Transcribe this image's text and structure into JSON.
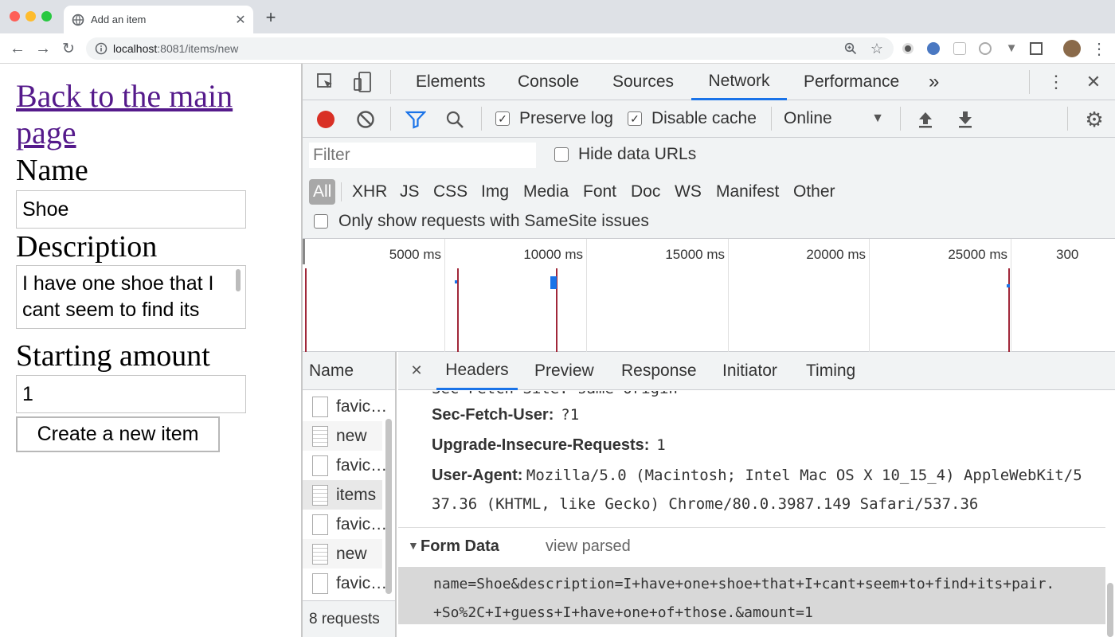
{
  "browser": {
    "tab_title": "Add an item",
    "url_host": "localhost",
    "url_rest": ":8081/items/new",
    "new_tab_symbol": "+"
  },
  "page": {
    "back_link": "Back to the main page",
    "name_label": "Name",
    "name_value": "Shoe",
    "description_label": "Description",
    "description_value": "I have one shoe that I cant seem to find its",
    "amount_label": "Starting amount",
    "amount_value": "1",
    "submit_label": "Create a new item"
  },
  "devtools": {
    "tabs": [
      "Elements",
      "Console",
      "Sources",
      "Network",
      "Performance"
    ],
    "active_tab": "Network",
    "more": "»",
    "preserve_log": "Preserve log",
    "disable_cache": "Disable cache",
    "throttle": "Online",
    "filter_placeholder": "Filter",
    "hide_data_urls": "Hide data URLs",
    "types": [
      "All",
      "XHR",
      "JS",
      "CSS",
      "Img",
      "Media",
      "Font",
      "Doc",
      "WS",
      "Manifest",
      "Other"
    ],
    "samesite": "Only show requests with SameSite issues",
    "timeline_ticks": [
      "5000 ms",
      "10000 ms",
      "15000 ms",
      "20000 ms",
      "25000 ms",
      "300"
    ],
    "name_header": "Name",
    "requests": [
      "favic…",
      "new",
      "favic…",
      "items",
      "favic…",
      "new",
      "favic…"
    ],
    "footer": "8 requests",
    "detail_tabs": [
      "Headers",
      "Preview",
      "Response",
      "Initiator",
      "Timing"
    ],
    "cut_header": "Sec-Fetch-Site: same-origin",
    "headers": [
      {
        "key": "Sec-Fetch-User:",
        "value": "?1"
      },
      {
        "key": "Upgrade-Insecure-Requests:",
        "value": "1"
      },
      {
        "key": "User-Agent:",
        "value": "Mozilla/5.0 (Macintosh; Intel Mac OS X 10_15_4) AppleWebKit/5"
      }
    ],
    "user_agent_cont": "37.36 (KHTML, like Gecko) Chrome/80.0.3987.149 Safari/537.36",
    "form_data_title": "Form Data",
    "view_parsed": "view parsed",
    "form_data_line1": "name=Shoe&description=I+have+one+shoe+that+I+cant+seem+to+find+its+pair.",
    "form_data_line2": "+So%2C+I+guess+I+have+one+of+those.&amount=1"
  },
  "colors": {
    "accent": "#1a73e8",
    "record": "#d93025",
    "link": "#551a8b",
    "marker": "#a1283a"
  }
}
